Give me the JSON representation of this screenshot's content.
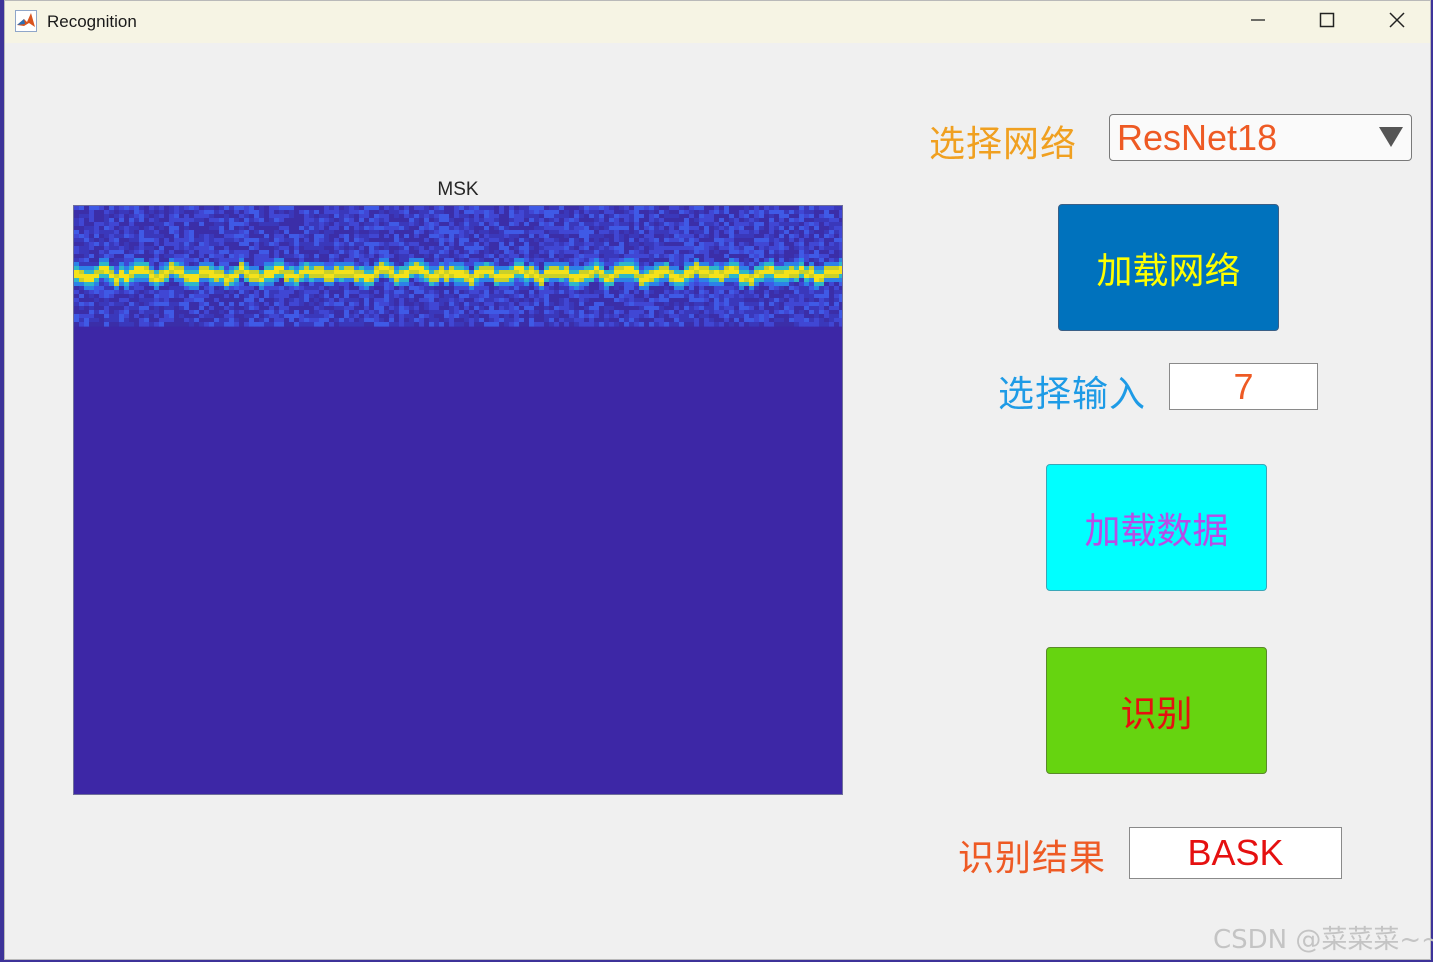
{
  "window": {
    "title": "Recognition",
    "app_icon": "matlab-icon"
  },
  "controls": {
    "minimize_icon": "minimize-icon",
    "maximize_icon": "maximize-icon",
    "close_icon": "close-icon"
  },
  "axes": {
    "title": "MSK"
  },
  "network": {
    "label": "选择网络",
    "selected": "ResNet18",
    "load_button": "加载网络"
  },
  "input": {
    "label": "选择输入",
    "value": "7",
    "load_button": "加载数据"
  },
  "recognize": {
    "button": "识别"
  },
  "result": {
    "label": "识别结果",
    "value": "BASK"
  },
  "watermark": "CSDN @菜菜菜~~",
  "colors": {
    "network_label": "#f0a020",
    "load_network_bg": "#0072bd",
    "load_network_text": "#ffff00",
    "input_label": "#1e9be6",
    "input_value": "#ee5a24",
    "load_data_bg": "#00ffff",
    "load_data_text": "#b84ce6",
    "recognize_bg": "#66d410",
    "recognize_text": "#e51010",
    "result_label": "#ee5a24",
    "result_value": "#e51010"
  }
}
